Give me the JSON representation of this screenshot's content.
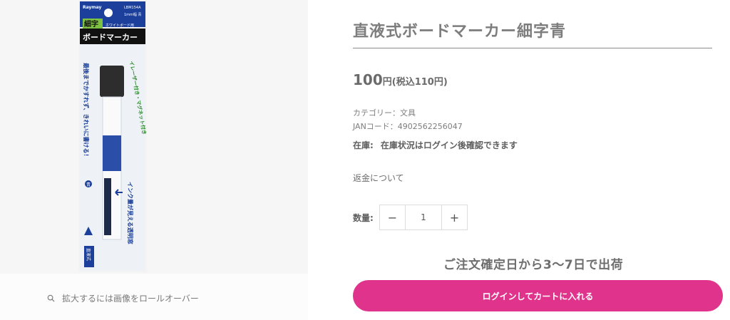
{
  "product": {
    "title": "直液式ボードマーカー細字青",
    "price_amount": "100",
    "price_yen": "円",
    "price_tax": "(税込110円)",
    "category": "カテゴリー：文具",
    "jan": "JANコード：4902562256047",
    "stock_label": "在庫:",
    "stock_text": "在庫状況はログイン後確認できます",
    "refund_link": "返金について",
    "qty_label": "数量:",
    "qty_value": "1",
    "qty_minus": "−",
    "qty_plus": "+",
    "shipping_note": "ご注文確定日から3〜7日で出荷",
    "cart_button": "ログインしてカートに入れる"
  },
  "gallery": {
    "zoom_hint": "拡大するには画像をロールオーバー",
    "package": {
      "brand": "Raymay",
      "model": "LBM154A",
      "spec": "1mm幅 青",
      "tag": "細字",
      "subtitle": "ホワイトボード用",
      "name": "ボードマーカー",
      "copy1": "最後までかすれず、きれいに書ける！",
      "copy2": "イレーザー付き・マグネット付き",
      "copy3": "インク量が見える透明窓",
      "color_badge": "青",
      "type_badge": "直液式"
    }
  },
  "colors": {
    "accent": "#e0348c",
    "text": "#6b6b6b"
  }
}
